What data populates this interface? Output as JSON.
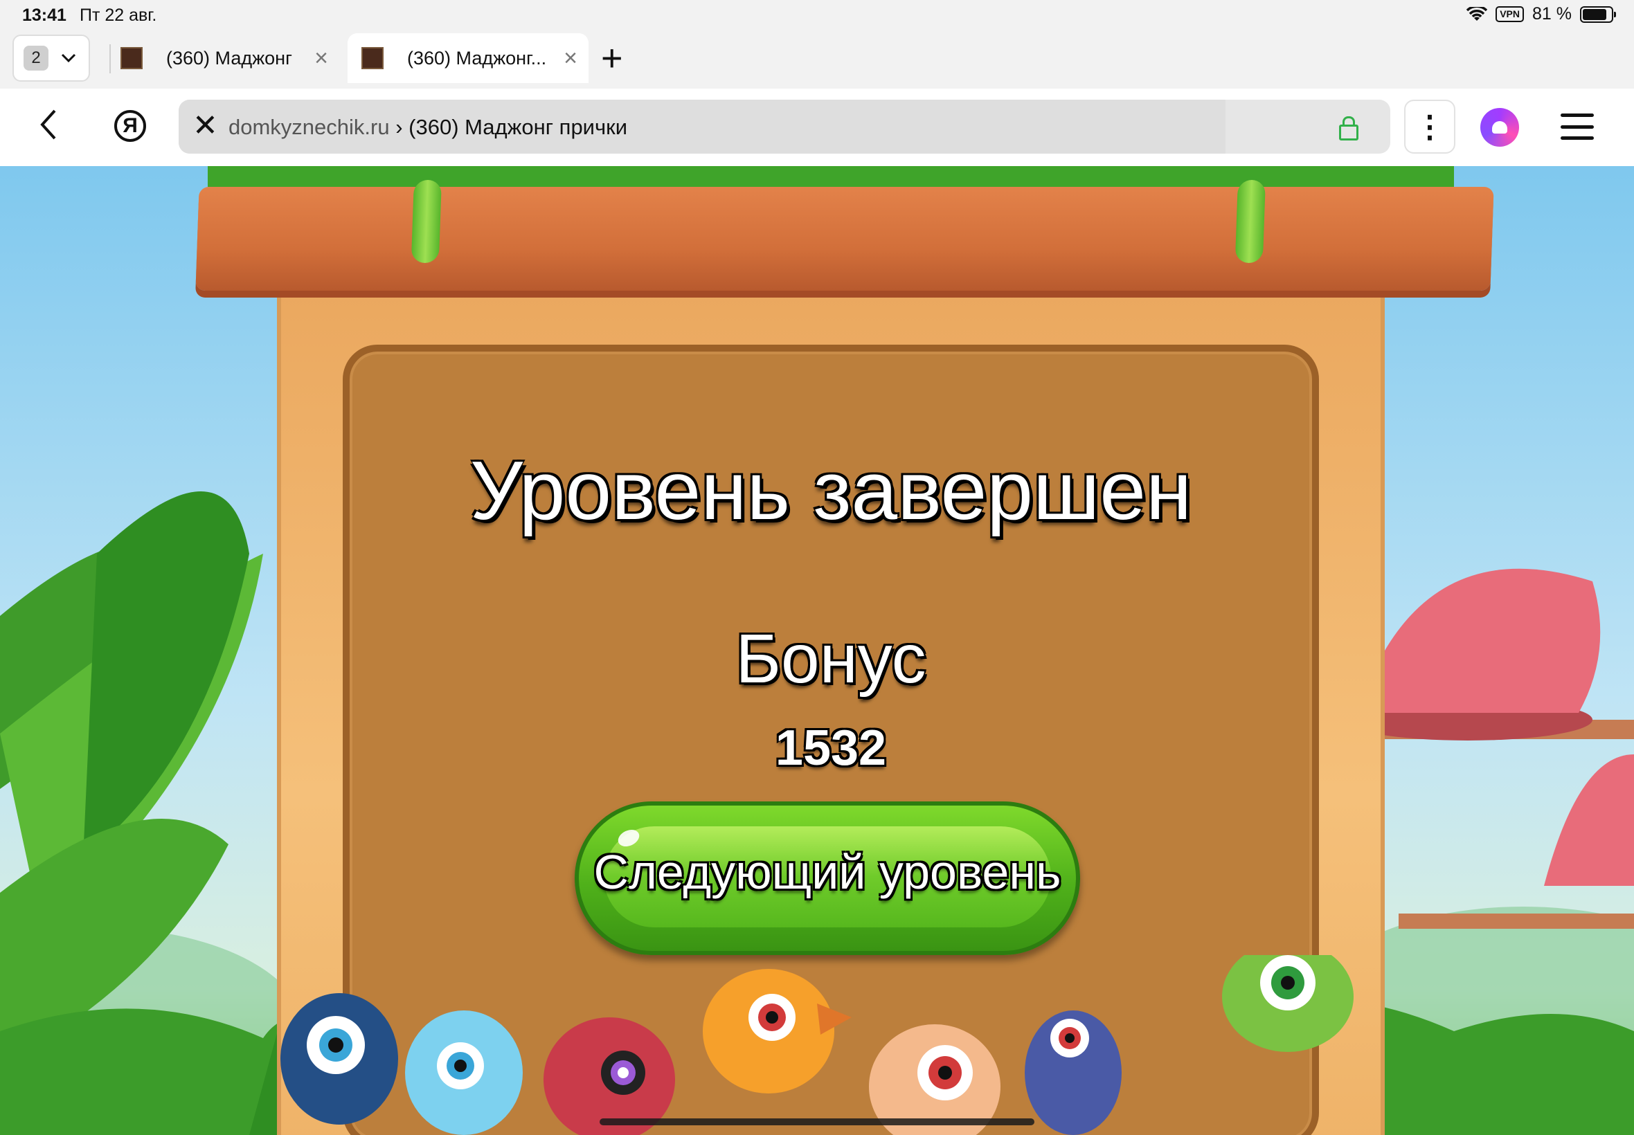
{
  "status_bar": {
    "time": "13:41",
    "date": "Пт 22 авг.",
    "vpn_label": "VPN",
    "battery_text": "81 %",
    "battery_level_percent": 81
  },
  "tabs": {
    "counter": "2",
    "items": [
      {
        "title": "(360) Маджонг",
        "active": false
      },
      {
        "title": "(360) Маджонг...",
        "active": true
      }
    ]
  },
  "address_bar": {
    "domain": "domkyznechik.ru",
    "separator": " › ",
    "page_title": "(360) Маджонг прички"
  },
  "game": {
    "title": "Уровень завершен",
    "bonus_label": "Бонус",
    "bonus_value": "1532",
    "next_button_label": "Следующий уровень"
  },
  "colors": {
    "button_green": "#4fb01a",
    "panel_brown": "#bc7f3c",
    "plank_orange": "#d26f3a",
    "lock_green": "#32b04a"
  }
}
